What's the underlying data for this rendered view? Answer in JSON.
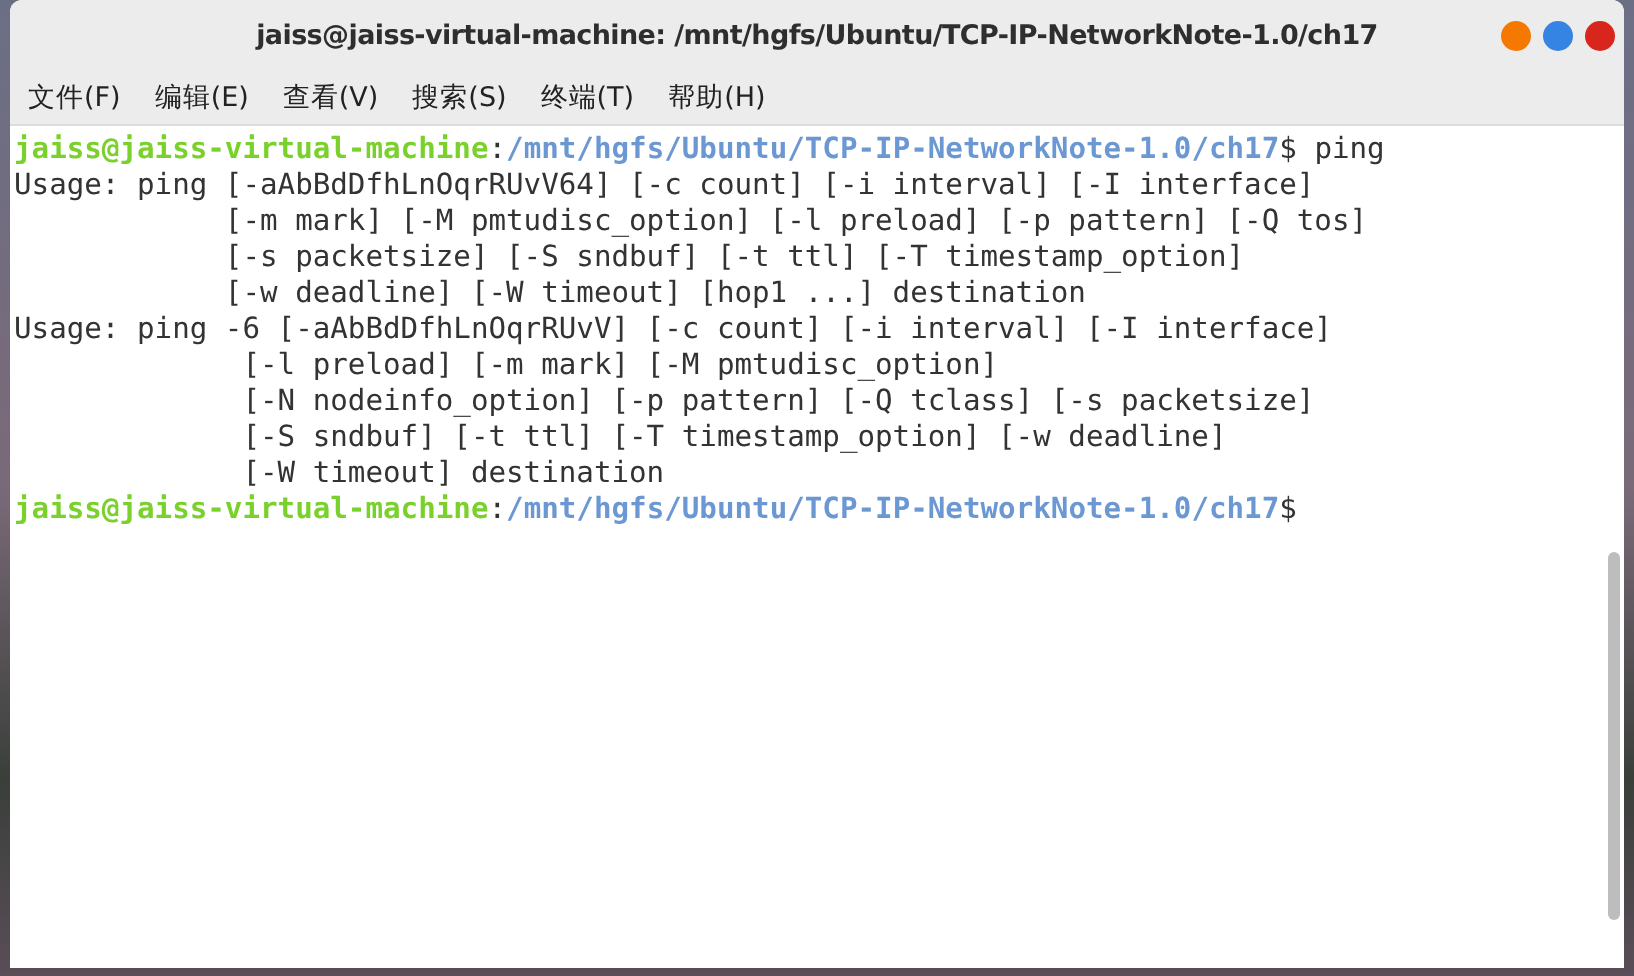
{
  "window": {
    "title": "jaiss@jaiss-virtual-machine: /mnt/hgfs/Ubuntu/TCP-IP-NetworkNote-1.0/ch17"
  },
  "menu": [
    "文件(F)",
    "编辑(E)",
    "查看(V)",
    "搜索(S)",
    "终端(T)",
    "帮助(H)"
  ],
  "terminal": {
    "lines": [
      {
        "kind": "prompt",
        "user": "jaiss@jaiss-virtual-machine",
        "separator": ":",
        "path": "/mnt/hgfs/Ubuntu/TCP-IP-NetworkNote-1.0/ch17",
        "command": "$ ping"
      },
      {
        "kind": "output",
        "text": "Usage: ping [-aAbBdDfhLnOqrRUvV64] [-c count] [-i interval] [-I interface]"
      },
      {
        "kind": "output",
        "text": "            [-m mark] [-M pmtudisc_option] [-l preload] [-p pattern] [-Q tos]"
      },
      {
        "kind": "output",
        "text": "            [-s packetsize] [-S sndbuf] [-t ttl] [-T timestamp_option]"
      },
      {
        "kind": "output",
        "text": "            [-w deadline] [-W timeout] [hop1 ...] destination"
      },
      {
        "kind": "output",
        "text": "Usage: ping -6 [-aAbBdDfhLnOqrRUvV] [-c count] [-i interval] [-I interface]"
      },
      {
        "kind": "output",
        "text": "             [-l preload] [-m mark] [-M pmtudisc_option]"
      },
      {
        "kind": "output",
        "text": "             [-N nodeinfo_option] [-p pattern] [-Q tclass] [-s packetsize]"
      },
      {
        "kind": "output",
        "text": "             [-S sndbuf] [-t ttl] [-T timestamp_option] [-w deadline]"
      },
      {
        "kind": "output",
        "text": "             [-W timeout] destination"
      },
      {
        "kind": "prompt",
        "user": "jaiss@jaiss-virtual-machine",
        "separator": ":",
        "path": "/mnt/hgfs/Ubuntu/TCP-IP-NetworkNote-1.0/ch17",
        "command": "$"
      }
    ]
  }
}
